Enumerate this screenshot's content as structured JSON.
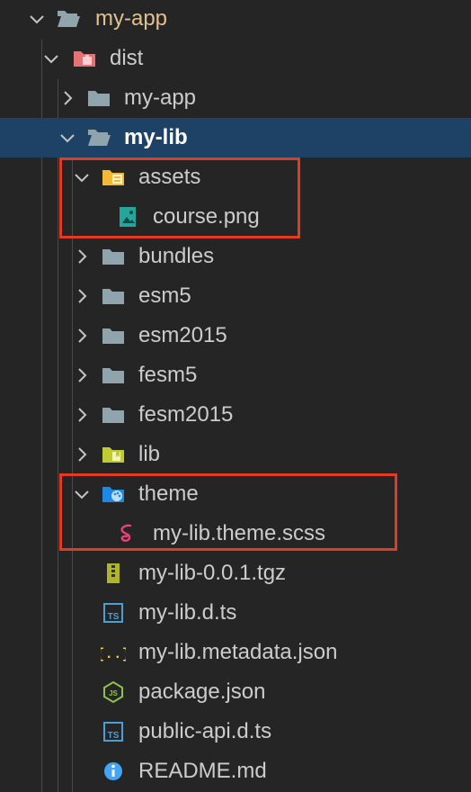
{
  "colors": {
    "background": "#252526",
    "selection": "#1e4266",
    "highlight_box": "#e23b22"
  },
  "tree": [
    {
      "label": "my-app",
      "depth": 0,
      "expanded": true,
      "icon": "folder-open-icon",
      "kind": "root"
    },
    {
      "label": "dist",
      "depth": 1,
      "expanded": true,
      "icon": "dist-folder-icon",
      "kind": "dist"
    },
    {
      "label": "my-app",
      "depth": 2,
      "expanded": false,
      "icon": "folder-icon"
    },
    {
      "label": "my-lib",
      "depth": 2,
      "expanded": true,
      "icon": "folder-open-icon",
      "selected": true
    },
    {
      "label": "assets",
      "depth": 3,
      "expanded": true,
      "icon": "assets-folder-icon"
    },
    {
      "label": "course.png",
      "depth": 4,
      "icon": "image-file-icon"
    },
    {
      "label": "bundles",
      "depth": 3,
      "expanded": false,
      "icon": "folder-icon"
    },
    {
      "label": "esm5",
      "depth": 3,
      "expanded": false,
      "icon": "folder-icon"
    },
    {
      "label": "esm2015",
      "depth": 3,
      "expanded": false,
      "icon": "folder-icon"
    },
    {
      "label": "fesm5",
      "depth": 3,
      "expanded": false,
      "icon": "folder-icon"
    },
    {
      "label": "fesm2015",
      "depth": 3,
      "expanded": false,
      "icon": "folder-icon"
    },
    {
      "label": "lib",
      "depth": 3,
      "expanded": false,
      "icon": "lib-folder-icon"
    },
    {
      "label": "theme",
      "depth": 3,
      "expanded": true,
      "icon": "theme-folder-icon"
    },
    {
      "label": "my-lib.theme.scss",
      "depth": 4,
      "icon": "sass-file-icon"
    },
    {
      "label": "my-lib-0.0.1.tgz",
      "depth": 3,
      "icon": "archive-file-icon"
    },
    {
      "label": "my-lib.d.ts",
      "depth": 3,
      "icon": "typescript-file-icon"
    },
    {
      "label": "my-lib.metadata.json",
      "depth": 3,
      "icon": "json-file-icon"
    },
    {
      "label": "package.json",
      "depth": 3,
      "icon": "node-file-icon"
    },
    {
      "label": "public-api.d.ts",
      "depth": 3,
      "icon": "typescript-file-icon"
    },
    {
      "label": "README.md",
      "depth": 3,
      "icon": "info-file-icon"
    }
  ],
  "highlights": [
    {
      "name": "assets-highlight",
      "from_row": 4,
      "to_row": 5
    },
    {
      "name": "theme-highlight",
      "from_row": 12,
      "to_row": 13
    }
  ]
}
